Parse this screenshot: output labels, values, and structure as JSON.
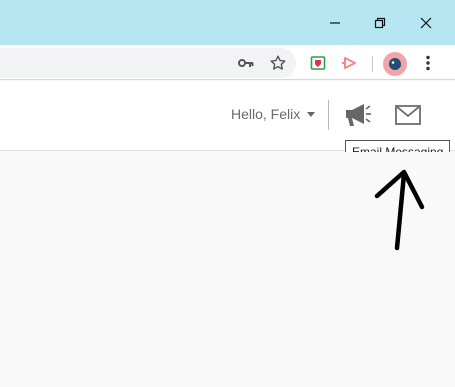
{
  "window": {
    "controls": [
      "minimize-icon",
      "restore-icon",
      "close-icon"
    ],
    "accent_color": "#b5e6f1"
  },
  "toolbar": {
    "icons": [
      "key-icon",
      "star-icon",
      "extension-shield-icon",
      "extension-play-icon",
      "avatar",
      "kebab-menu-icon"
    ]
  },
  "header": {
    "greeting": "Hello, Felix",
    "icons": [
      "megaphone-icon",
      "mail-icon"
    ]
  },
  "tooltip": {
    "text": "Email Messaging"
  }
}
